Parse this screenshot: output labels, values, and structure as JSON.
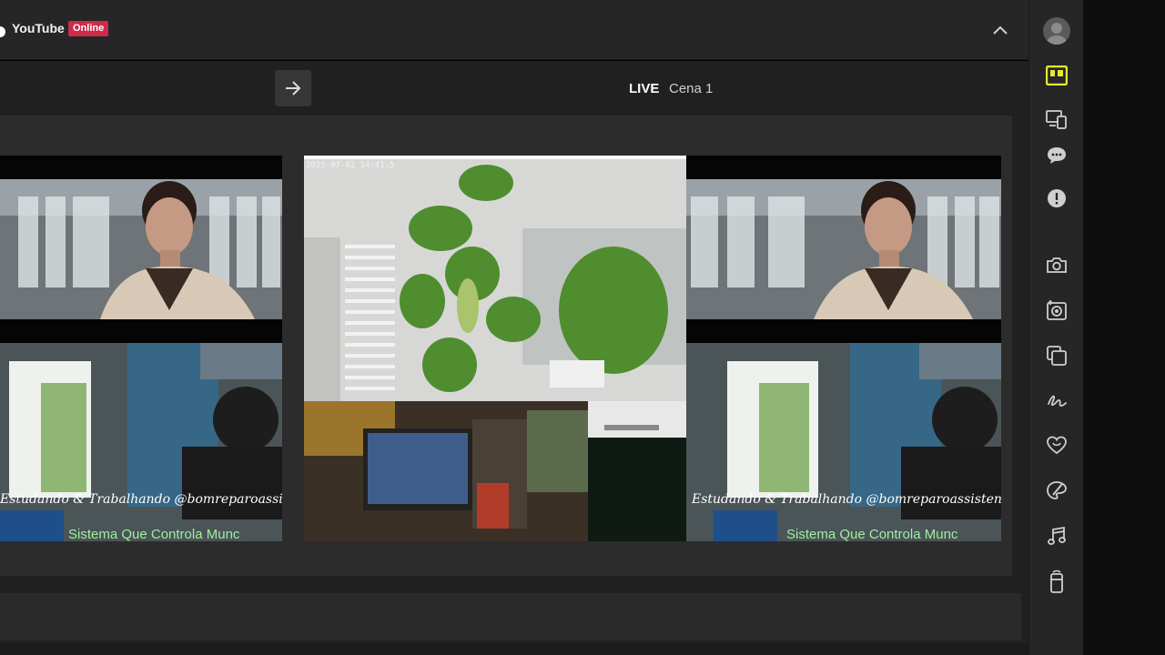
{
  "header": {
    "service_name": "YouTube",
    "status_badge": "Online"
  },
  "toolbar": {
    "live_label": "LIVE",
    "scene_name": "Cena 1"
  },
  "preview": {
    "overlay_text_1": "Estudando & Trabalhando @bomreparoassistenc",
    "overlay_text_2": "Sistema Que Controla Munc",
    "camera_timestamp": "2025-07-02 14:41:5"
  },
  "sidebar": {
    "items": [
      {
        "icon": "layout-icon",
        "active": true
      },
      {
        "icon": "devices-icon"
      },
      {
        "icon": "chat-icon"
      },
      {
        "icon": "alert-icon"
      },
      {
        "icon": "camera-icon"
      },
      {
        "icon": "camera-flip-icon"
      },
      {
        "icon": "layers-icon"
      },
      {
        "icon": "signature-icon"
      },
      {
        "icon": "heart-icon"
      },
      {
        "icon": "palette-icon"
      },
      {
        "icon": "music-icon"
      },
      {
        "icon": "remote-icon"
      }
    ]
  },
  "colors": {
    "accent": "#e5e832",
    "badge": "#cc2b4a",
    "overlay_text": "#9ff09f"
  }
}
